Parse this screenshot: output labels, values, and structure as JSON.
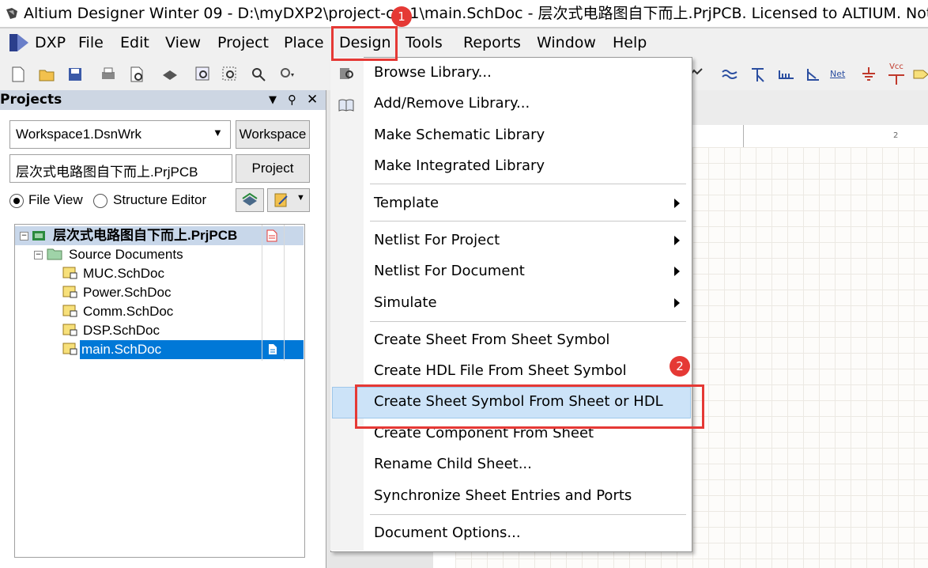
{
  "window": {
    "title": "Altium Designer Winter 09 - D:\\myDXP2\\project-css1\\main.SchDoc - 层次式电路图自下而上.PrjPCB. Licensed to ALTIUM. Not signed"
  },
  "menubar": {
    "items": [
      "DXP",
      "File",
      "Edit",
      "View",
      "Project",
      "Place",
      "Design",
      "Tools",
      "Reports",
      "Window",
      "Help"
    ]
  },
  "panel": {
    "title": "Projects",
    "workspace_value": "Workspace1.DsnWrk",
    "workspace_button": "Workspace",
    "project_value": "层次式电路图自下而上.PrjPCB",
    "project_button": "Project",
    "file_view_label": "File View",
    "structure_editor_label": "Structure Editor"
  },
  "tree": {
    "project": "层次式电路图自下而上.PrjPCB",
    "folder": "Source Documents",
    "docs": [
      "MUC.SchDoc",
      "Power.SchDoc",
      "Comm.SchDoc",
      "DSP.SchDoc",
      "main.SchDoc"
    ]
  },
  "sheet": {
    "ruler_label": "2"
  },
  "design_menu": {
    "items": [
      "Browse Library...",
      "Add/Remove Library...",
      "Make Schematic Library",
      "Make Integrated Library",
      "Template",
      "Netlist For Project",
      "Netlist For Document",
      "Simulate",
      "Create Sheet From Sheet Symbol",
      "Create HDL File From Sheet Symbol",
      "Create Sheet Symbol From Sheet or HDL",
      "Create Component From Sheet",
      "Rename Child Sheet...",
      "Synchronize Sheet Entries and Ports",
      "Document Options..."
    ],
    "highlighted": "Create Sheet Symbol From Sheet or HDL"
  },
  "annotations": {
    "badge1": "1",
    "badge2": "2"
  },
  "toolbar_right": {
    "netlabel": "Net",
    "vcc": "Vcc"
  },
  "colors": {
    "accent_red": "#e53935",
    "selection_blue": "#0078d7",
    "menu_highlight": "#cce3f8"
  }
}
